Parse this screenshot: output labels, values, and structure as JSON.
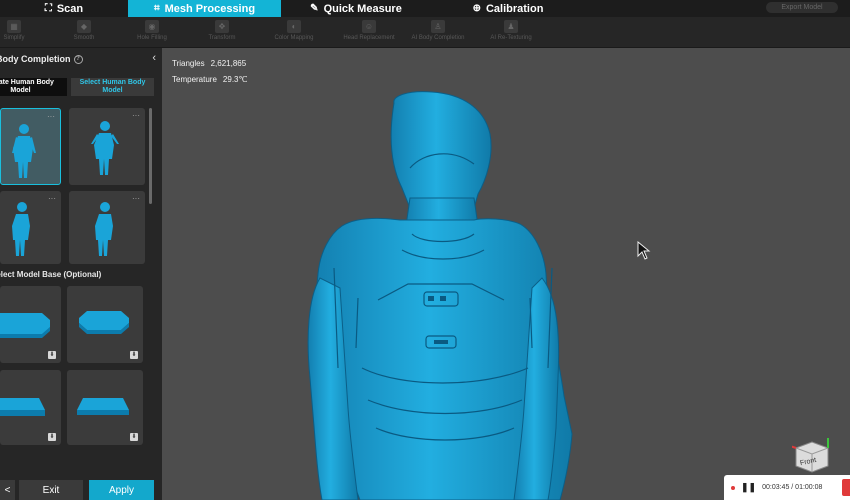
{
  "tabs": [
    {
      "label": "Scan",
      "icon": "scan-icon"
    },
    {
      "label": "Mesh Processing",
      "icon": "mesh-icon"
    },
    {
      "label": "Quick Measure",
      "icon": "ruler-icon"
    },
    {
      "label": "Calibration",
      "icon": "crosshair-icon"
    }
  ],
  "export_label": "Export Model",
  "tools": [
    {
      "label": "Simplify"
    },
    {
      "label": "Smooth"
    },
    {
      "label": "Hole Filling"
    },
    {
      "label": "Transform"
    },
    {
      "label": "Color Mapping"
    },
    {
      "label": "Head Replacement"
    },
    {
      "label": "AI Body Completion"
    },
    {
      "label": "AI Re-Texturing"
    }
  ],
  "panel": {
    "title": "Body Completion",
    "segment_create": "Create Human Body Model",
    "segment_select": "Select Human Body Model",
    "base_label": "Select Model Base (Optional)",
    "exit_label": "Exit",
    "apply_label": "Apply",
    "back_label": "<"
  },
  "stats": {
    "triangles_label": "Triangles",
    "triangles_value": "2,621,865",
    "temperature_label": "Temperature",
    "temperature_value": "29.3℃"
  },
  "cube_label": "Front",
  "player": {
    "time": "00:03:45 / 01:00:08"
  },
  "colors": {
    "accent": "#13b4d6",
    "model": "#1a9fcf"
  }
}
